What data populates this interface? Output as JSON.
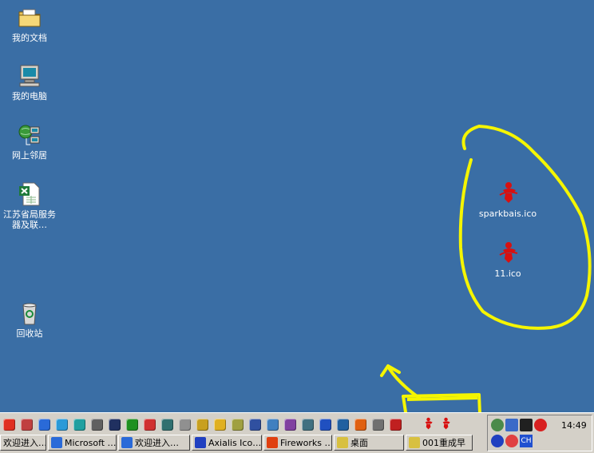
{
  "desktop": {
    "icons": [
      {
        "label": "我的文档",
        "icon": "folder-documents-icon"
      },
      {
        "label": "我的电脑",
        "icon": "computer-icon"
      },
      {
        "label": "网上邻居",
        "icon": "network-icon"
      },
      {
        "label": "江苏省局服务器及联…",
        "icon": "excel-file-icon"
      },
      {
        "label": "回收站",
        "icon": "recycle-bin-icon"
      }
    ],
    "files": [
      {
        "label": "sparkbais.ico",
        "icon": "red-mascot-icon"
      },
      {
        "label": "11.ico",
        "icon": "red-mascot-icon"
      }
    ],
    "annotation_color": "#f5f500"
  },
  "taskbar": {
    "quick_launch_count": 23,
    "buttons": [
      {
        "label": "欢迎进入…",
        "icon": "ie-icon"
      },
      {
        "label": "Microsoft …",
        "icon": "ie-icon"
      },
      {
        "label": "欢迎进入…",
        "icon": "ie-icon"
      },
      {
        "label": "Axialis Ico…",
        "icon": "axialis-icon"
      },
      {
        "label": "Fireworks …",
        "icon": "fireworks-icon"
      },
      {
        "label": "桌面",
        "icon": "explorer-icon"
      },
      {
        "label": "001重成早",
        "icon": "explorer-icon"
      }
    ],
    "tray": {
      "clock": "14:49",
      "lang": "CH"
    }
  }
}
